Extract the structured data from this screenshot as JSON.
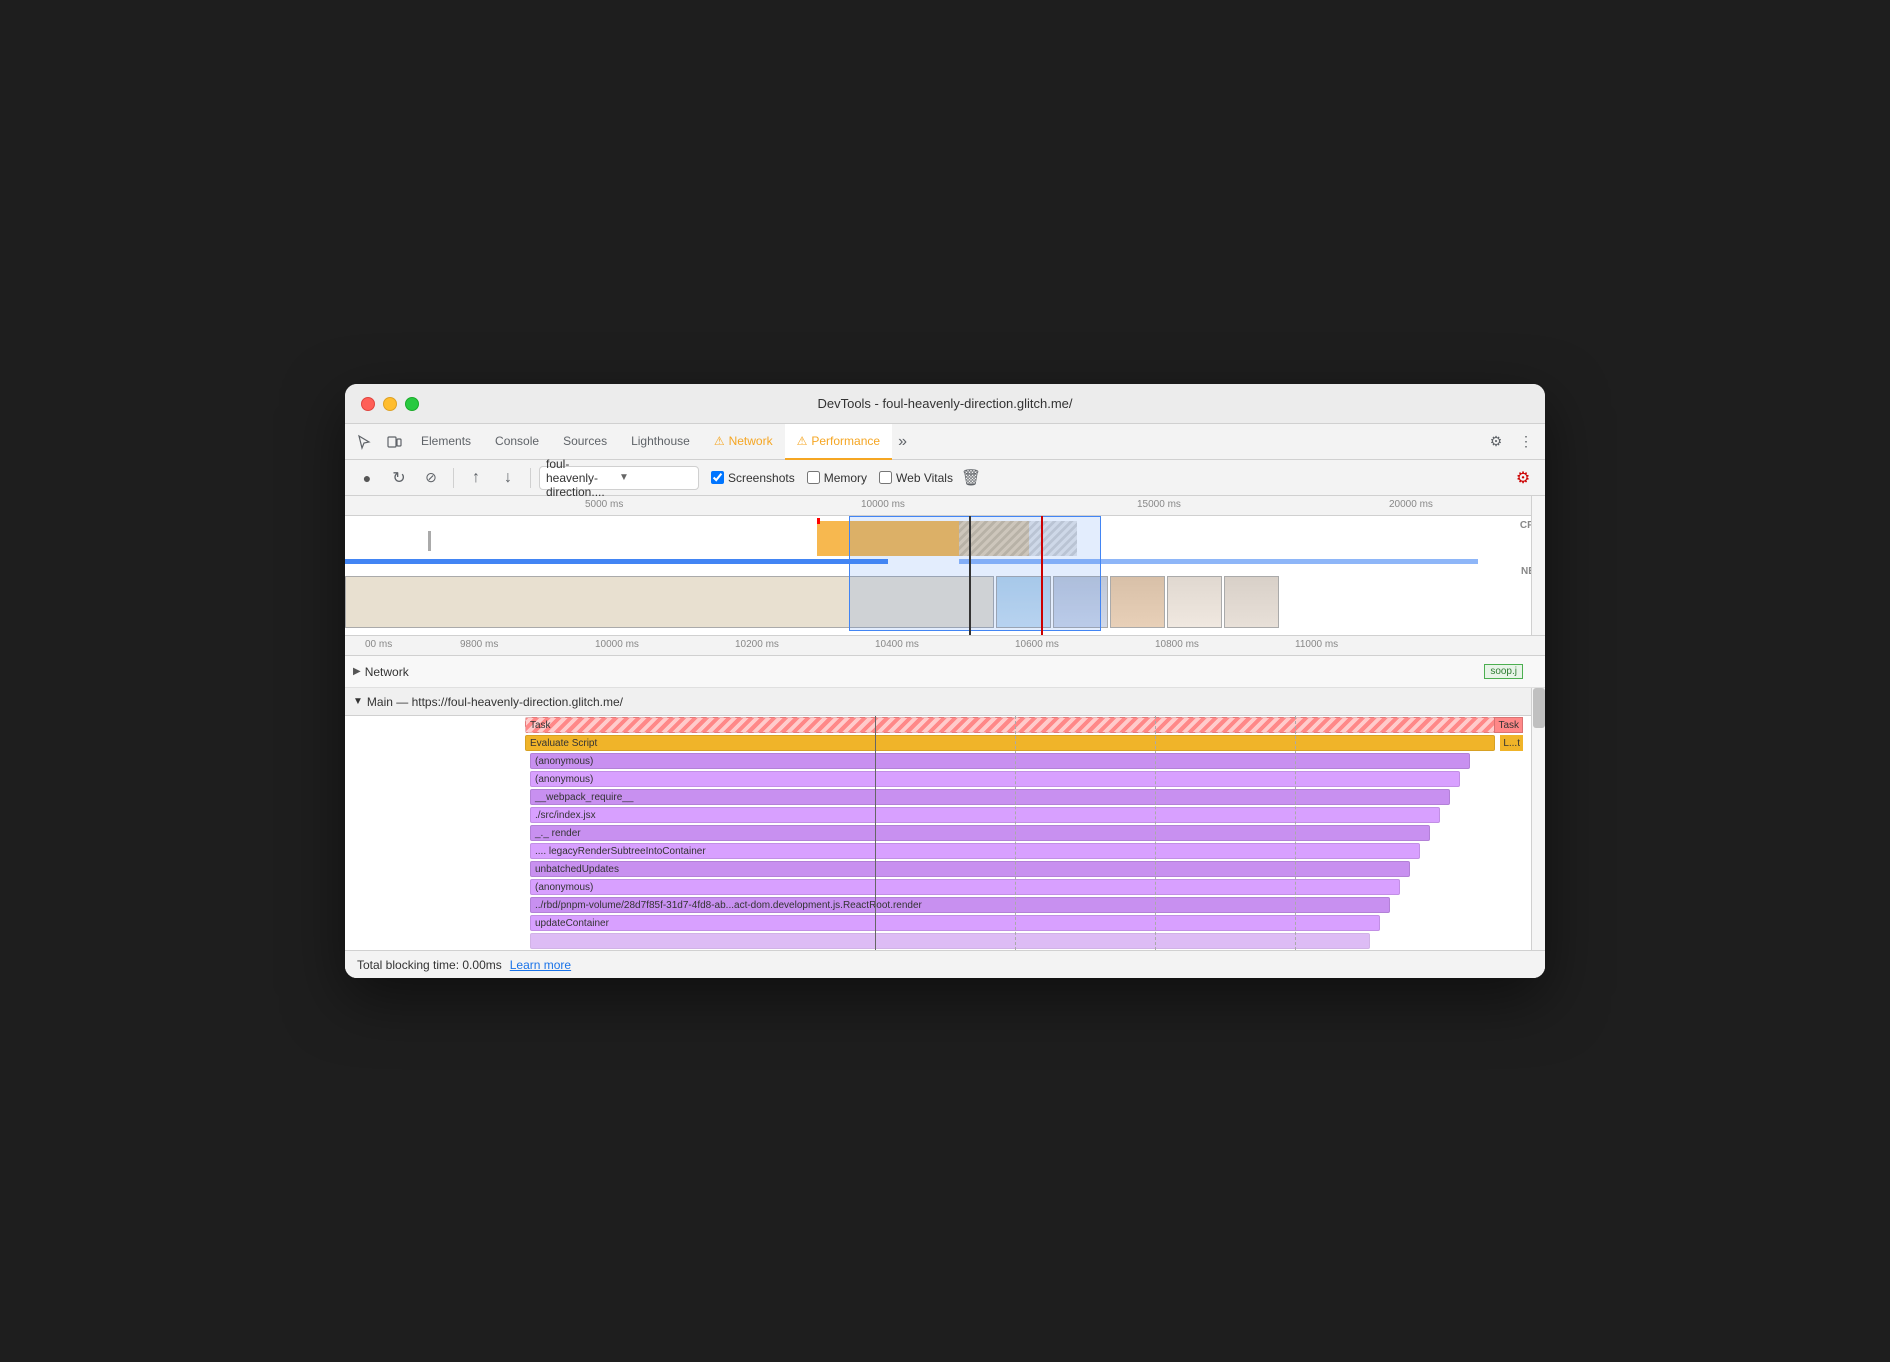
{
  "window": {
    "title": "DevTools - foul-heavenly-direction.glitch.me/"
  },
  "tabs": [
    {
      "id": "cursor-tab",
      "label": "",
      "icon": "cursor"
    },
    {
      "id": "device-tab",
      "label": "",
      "icon": "device"
    },
    {
      "id": "elements",
      "label": "Elements"
    },
    {
      "id": "console",
      "label": "Console"
    },
    {
      "id": "sources",
      "label": "Sources"
    },
    {
      "id": "lighthouse",
      "label": "Lighthouse"
    },
    {
      "id": "network",
      "label": "Network",
      "warning": true
    },
    {
      "id": "performance",
      "label": "Performance",
      "warning": true,
      "active": true
    },
    {
      "id": "more",
      "label": "»"
    }
  ],
  "toolbar": {
    "record_label": "●",
    "reload_label": "↻",
    "stop_label": "⊘",
    "upload_label": "↑",
    "download_label": "↓",
    "dropdown_value": "foul-heavenly-direction....",
    "screenshots_label": "Screenshots",
    "memory_label": "Memory",
    "web_vitals_label": "Web Vitals",
    "settings_gear": "⚙",
    "more_dots": "⋮"
  },
  "timeline": {
    "overview_ticks": [
      "5000 ms",
      "10000 ms",
      "15000 ms",
      "20000 ms"
    ],
    "detail_ticks": [
      "00 ms",
      "9800 ms",
      "10000 ms",
      "10200 ms",
      "10400 ms",
      "10600 ms",
      "10800 ms",
      "11000 ms"
    ],
    "cpu_label": "CPU",
    "net_label": "NET"
  },
  "network_row": {
    "label": "Network",
    "expanded": false,
    "right_label": "soop.j"
  },
  "flame": {
    "main_header": "Main — https://foul-heavenly-direction.glitch.me/",
    "rows": [
      {
        "label": "Task",
        "type": "task",
        "right_label": "Task"
      },
      {
        "label": "Evaluate Script",
        "type": "evaluate",
        "right_label": "L...t"
      },
      {
        "label": "(anonymous)",
        "type": "func",
        "indent": 1
      },
      {
        "label": "(anonymous)",
        "type": "func",
        "indent": 2
      },
      {
        "label": "__webpack_require__",
        "type": "func",
        "indent": 3
      },
      {
        "label": "./src/index.jsx",
        "type": "func",
        "indent": 4
      },
      {
        "label": "_._   render",
        "type": "func",
        "indent": 5
      },
      {
        "label": "....  legacyRenderSubtreeIntoContainer",
        "type": "func",
        "indent": 6
      },
      {
        "label": "unbatchedUpdates",
        "type": "func",
        "indent": 7
      },
      {
        "label": "(anonymous)",
        "type": "func",
        "indent": 8
      },
      {
        "label": "../rbd/pnpm-volume/28d7f85f-31d7-4fd8-ab...act-dom.development.js.ReactRoot.render",
        "type": "func",
        "indent": 9
      },
      {
        "label": "updateContainer",
        "type": "func",
        "indent": 10
      }
    ]
  },
  "status_bar": {
    "text": "Total blocking time: 0.00ms",
    "learn_more": "Learn more"
  },
  "colors": {
    "accent_blue": "#1a73e8",
    "warning_yellow": "#f5a623",
    "task_red": "#ff8888",
    "evaluate_gold": "#f0b429",
    "func_purple": "#d8a0ff",
    "tab_active_underline": "#f5a623"
  }
}
